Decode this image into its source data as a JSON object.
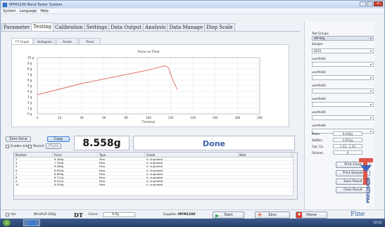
{
  "window": {
    "title": "MFM1200 Bond Tester System"
  },
  "menu": [
    "System",
    "Language",
    "Help"
  ],
  "tabs": [
    "Parameter",
    "Testing",
    "Calibration",
    "Settings",
    "Data Output",
    "Analysis",
    "Data Manage",
    "Disp Scale"
  ],
  "active_tab": "Testing",
  "subtabs": [
    "F-T Graph",
    "Histogram",
    "Pareto",
    "Trend"
  ],
  "active_subtab": "F-T Graph",
  "chart_data": {
    "type": "line",
    "title": "Force vs Time",
    "xlabel": "Time(ms)",
    "ylabel": "",
    "xlim": [
      0,
      200
    ],
    "ylim": [
      0,
      10
    ],
    "xticks": [
      0,
      20,
      40,
      60,
      80,
      100,
      120,
      140,
      160,
      180,
      200
    ],
    "yticks": [
      "0 g",
      "1 g",
      "2 g",
      "3 g",
      "4 g",
      "5 g",
      "6 g",
      "7 g",
      "8 g",
      "9 g",
      "10 g"
    ],
    "grid": true,
    "series": [
      {
        "color": "#e05a4a",
        "x": [
          0,
          10,
          20,
          30,
          40,
          50,
          60,
          70,
          80,
          90,
          100,
          108,
          112,
          115,
          118,
          120,
          123,
          126
        ],
        "y": [
          3.4,
          3.9,
          4.4,
          4.9,
          5.4,
          5.8,
          6.2,
          6.6,
          7.0,
          7.4,
          7.8,
          8.2,
          8.4,
          8.56,
          8.2,
          7.0,
          5.5,
          4.3
        ]
      }
    ]
  },
  "controls": {
    "zero_force": "Zero force",
    "copy": "Copy",
    "enable_side": "Enable side",
    "record": "Record",
    "photo": "Photo"
  },
  "readout": "8.558g",
  "status": "Done",
  "table": {
    "columns": [
      "Number",
      "Force",
      "Type",
      "Grade",
      "Note"
    ],
    "rows": [
      [
        "3",
        "8.268g",
        "Pass",
        "0: ungraded",
        ""
      ],
      [
        "4",
        "7.764g",
        "Pass",
        "0: ungraded",
        ""
      ],
      [
        "5",
        "8.486g",
        "Pass",
        "0: ungraded",
        ""
      ],
      [
        "6",
        "8.630g",
        "Pass",
        "0: ungraded",
        ""
      ],
      [
        "7",
        "8.696g",
        "Pass",
        "0: ungraded",
        ""
      ],
      [
        "8",
        "8.712g",
        "Pass",
        "0: ungraded",
        ""
      ],
      [
        "9",
        "8.932g",
        "Pass",
        "0: ungraded",
        ""
      ],
      [
        "10",
        "8.558g",
        "Pass",
        "0: ungraded",
        ""
      ]
    ]
  },
  "right": {
    "test_groups_label": "Test Groups:",
    "test_groups_value": "WP-60g",
    "sample_label": "Sample:",
    "sample_value": "0015",
    "userfields": [
      "userfield1",
      "userfield2",
      "userfield3",
      "userfield4",
      "userfield5",
      "userfield6"
    ],
    "stats": [
      {
        "label": "Mean:",
        "value": "8.640g"
      },
      {
        "label": "StdDev:",
        "value": "0.655g"
      },
      {
        "label": "Cpk, Cp:",
        "value": "1.05, -1.20"
      },
      {
        "label": "Failures:",
        "value": "0"
      }
    ],
    "buttons": [
      "Print Chart",
      "Print Sample",
      "Save Result",
      "Clear Result"
    ],
    "logo_text": "PRECISION"
  },
  "bottom": {
    "vac": "Vac",
    "wirepull": "WirePull-100g",
    "dt": "DT",
    "force_label": "Force:",
    "force_value": "0.0g",
    "supplier_label": "Supplier:",
    "supplier_value": "MFM1200",
    "start": "Start",
    "zero": "Zero",
    "home": "Home",
    "fine": "Fine"
  },
  "taskbar": {
    "time": "10:34"
  }
}
